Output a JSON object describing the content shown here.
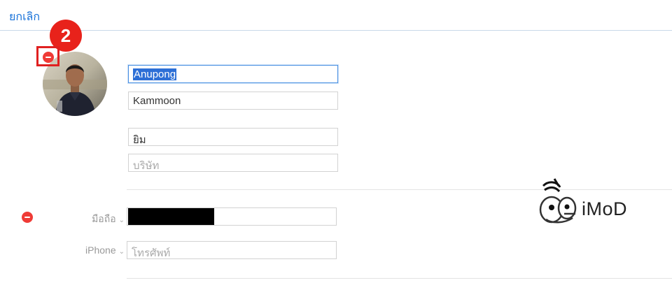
{
  "header": {
    "cancel_label": "ยกเลิก"
  },
  "annotation": {
    "step_number": "2"
  },
  "contact": {
    "first_name": "Anupong",
    "last_name": "Kammoon",
    "nickname": "ยิม",
    "company_placeholder": "บริษัท"
  },
  "phones": [
    {
      "label": "มือถือ",
      "value": ""
    },
    {
      "label": "iPhone",
      "placeholder": "โทรศัพท์"
    }
  ],
  "watermark": {
    "text": "iMoD"
  },
  "colors": {
    "accent": "#1a73d9",
    "delete": "#ef3b36",
    "badge": "#e8221b"
  }
}
